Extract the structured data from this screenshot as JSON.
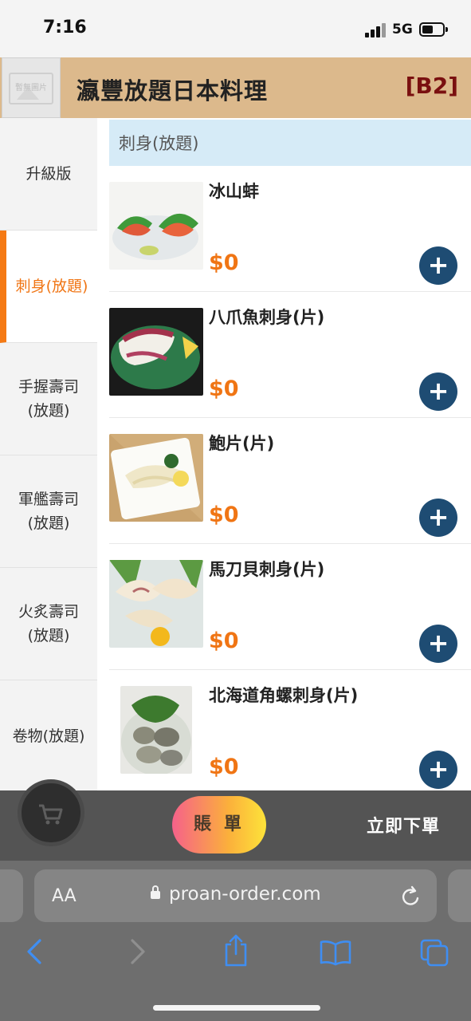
{
  "status": {
    "time": "7:16",
    "network": "5G"
  },
  "header": {
    "logo_text": "暫無圖片",
    "title": "瀛豐放題日本料理",
    "table": "[B2]"
  },
  "sidebar": {
    "items": [
      {
        "label": "升級版"
      },
      {
        "label": "刺身(放題)",
        "active": true
      },
      {
        "label": "手握壽司\n(放題)"
      },
      {
        "label": "軍艦壽司\n(放題)"
      },
      {
        "label": "火炙壽司\n(放題)"
      },
      {
        "label": "卷物(放題)"
      }
    ]
  },
  "section": {
    "title": "刺身(放題)"
  },
  "menu": {
    "items": [
      {
        "name": "冰山蚌",
        "price": "$0"
      },
      {
        "name": "八爪魚刺身(片)",
        "price": "$0"
      },
      {
        "name": "鮑片(片)",
        "price": "$0"
      },
      {
        "name": "馬刀貝刺身(片)",
        "price": "$0"
      },
      {
        "name": "北海道角螺刺身(片)",
        "price": "$0"
      }
    ]
  },
  "order_bar": {
    "bill_label": "賬 單",
    "order_now_label": "立即下單"
  },
  "browser": {
    "aa_label": "AA",
    "url": "proan-order.com"
  },
  "colors": {
    "header_bg": "#dcb98c",
    "accent": "#f07514",
    "add_button": "#1e4c73",
    "table_no": "#7a1010"
  }
}
